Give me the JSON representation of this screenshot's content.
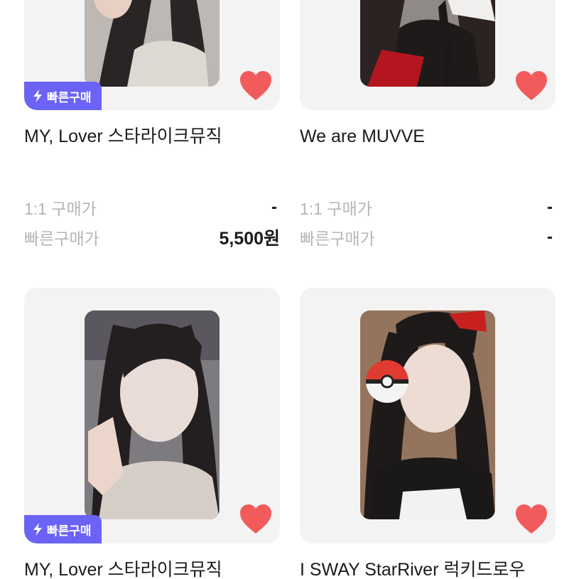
{
  "products": [
    {
      "title": "MY, Lover 스타라이크뮤직",
      "badge": "빠른구매",
      "price_1to1_label": "1:1 구매가",
      "price_1to1_value": "-",
      "price_fast_label": "빠른구매가",
      "price_fast_value": "5,500원"
    },
    {
      "title": "We are MUVVE",
      "price_1to1_label": "1:1 구매가",
      "price_1to1_value": "-",
      "price_fast_label": "빠른구매가",
      "price_fast_value": "-"
    },
    {
      "title": "MY, Lover 스타라이크뮤직",
      "badge": "빠른구매"
    },
    {
      "title": "I SWAY StarRiver 럭키드로우"
    }
  ],
  "colors": {
    "badge_bg": "#6b63f6",
    "heart": "#f25b5b",
    "card_bg": "#f3f3f4",
    "muted_text": "#b5b5b8"
  },
  "icons": {
    "like": "heart-icon",
    "fast_buy": "lightning-icon"
  }
}
